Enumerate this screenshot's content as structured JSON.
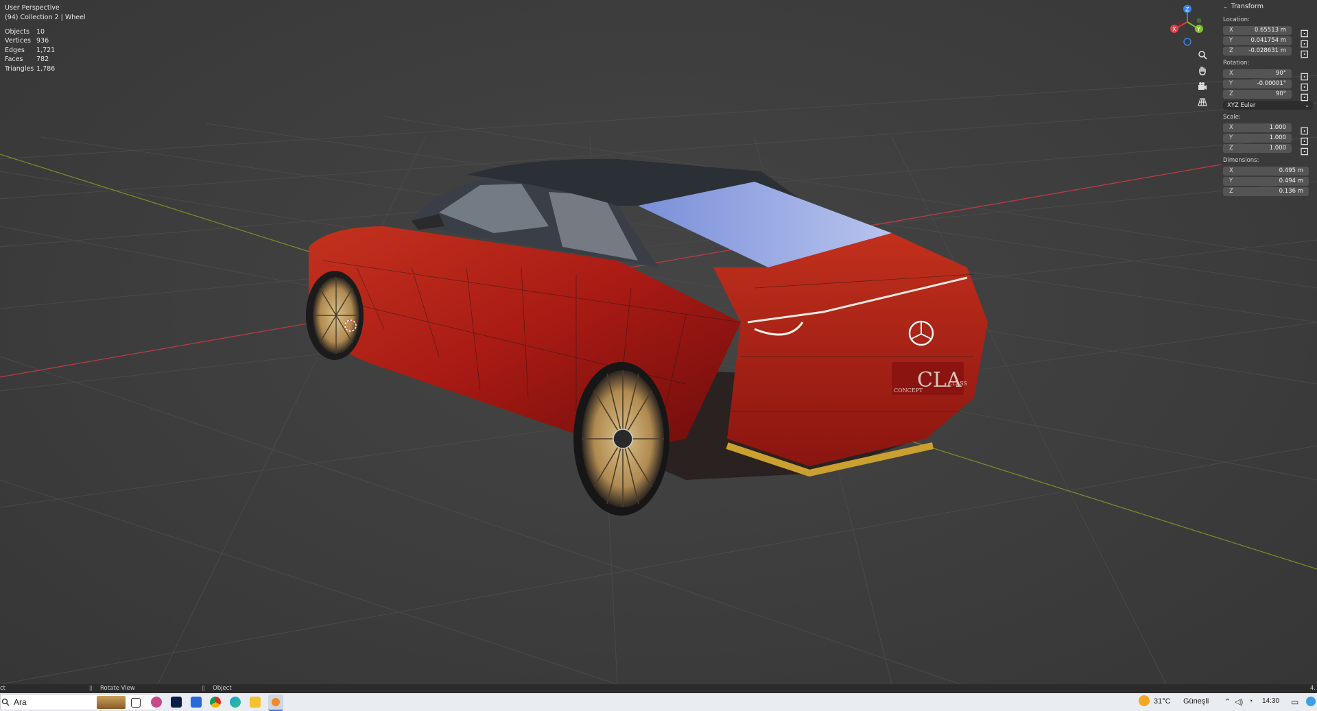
{
  "viewport": {
    "view_name": "User Perspective",
    "collection_info": "(94) Collection 2 | Wheel",
    "stats": [
      {
        "label": "Objects",
        "value": "10"
      },
      {
        "label": "Vertices",
        "value": "936"
      },
      {
        "label": "Edges",
        "value": "1,721"
      },
      {
        "label": "Faces",
        "value": "782"
      },
      {
        "label": "Triangles",
        "value": "1,786"
      }
    ],
    "gizmo": {
      "z": "Z",
      "x": "X",
      "y": "Y"
    },
    "car_badge": "CLA",
    "car_badge_left": "CONCEPT",
    "car_badge_right": "CLASS"
  },
  "npanel": {
    "header": "Transform",
    "location_label": "Location:",
    "location": [
      {
        "axis": "X",
        "value": "0.65513 m"
      },
      {
        "axis": "Y",
        "value": "0.041754 m"
      },
      {
        "axis": "Z",
        "value": "-0.028631 m"
      }
    ],
    "rotation_label": "Rotation:",
    "rotation": [
      {
        "axis": "X",
        "value": "90°"
      },
      {
        "axis": "Y",
        "value": "-0.00001°"
      },
      {
        "axis": "Z",
        "value": "90°"
      }
    ],
    "rotation_mode": "XYZ Euler",
    "scale_label": "Scale:",
    "scale": [
      {
        "axis": "X",
        "value": "1.000"
      },
      {
        "axis": "Y",
        "value": "1.000"
      },
      {
        "axis": "Z",
        "value": "1.000"
      }
    ],
    "dimensions_label": "Dimensions:",
    "dimensions": [
      {
        "axis": "X",
        "value": "0.495 m"
      },
      {
        "axis": "Y",
        "value": "0.494 m"
      },
      {
        "axis": "Z",
        "value": "0.136 m"
      }
    ]
  },
  "statusbar": {
    "left": "ct",
    "middle_left": "Rotate View",
    "middle": "Object",
    "right": "4."
  },
  "taskbar": {
    "search_placeholder": "Ara",
    "temperature": "31°C",
    "weather": "Güneşli",
    "time": "14:30"
  },
  "colors": {
    "viewport_bg": "#3d3d3d",
    "axis_x": "#b83c44",
    "axis_y": "#7a8a2a",
    "car_body": "#b0201a",
    "gizmo_x": "#e0404a",
    "gizmo_y": "#7fbf2a",
    "gizmo_z": "#3b82e0"
  }
}
